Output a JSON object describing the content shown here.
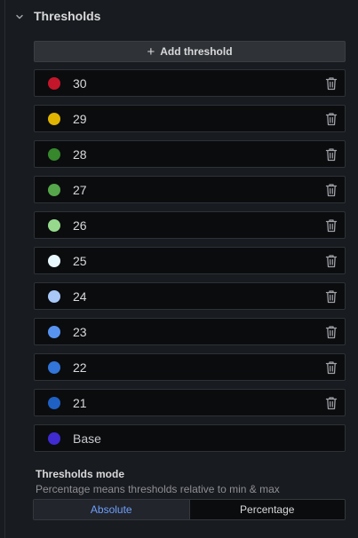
{
  "section": {
    "title": "Thresholds",
    "add_label": "Add threshold"
  },
  "thresholds": [
    {
      "value": "30",
      "color": "#c4162a"
    },
    {
      "value": "29",
      "color": "#e0b400"
    },
    {
      "value": "28",
      "color": "#37872d"
    },
    {
      "value": "27",
      "color": "#56a64b"
    },
    {
      "value": "26",
      "color": "#96d98d"
    },
    {
      "value": "25",
      "color": "#e8f8ff"
    },
    {
      "value": "24",
      "color": "#a8c8f8"
    },
    {
      "value": "23",
      "color": "#5794f2"
    },
    {
      "value": "22",
      "color": "#3274d9"
    },
    {
      "value": "21",
      "color": "#1f60c4"
    }
  ],
  "base": {
    "label": "Base",
    "color": "#3f2bd1"
  },
  "mode": {
    "title": "Thresholds mode",
    "description": "Percentage means thresholds relative to min & max",
    "options": [
      "Absolute",
      "Percentage"
    ],
    "selected": "Absolute"
  }
}
